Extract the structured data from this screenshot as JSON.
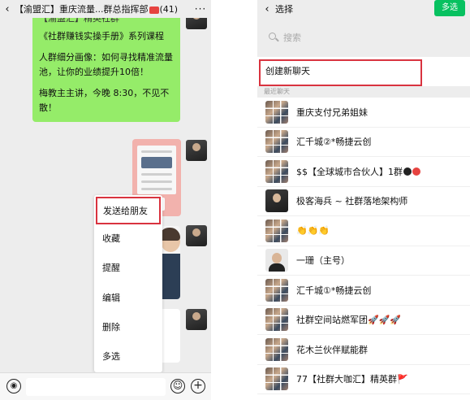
{
  "left_chat": {
    "back": "‹",
    "title": "【渝盟汇】重庆流量...群总指挥部",
    "member_count": "(41)",
    "more": "···",
    "message_cut_line": "【渝盟汇】精英社群",
    "message_paragraphs": [
      "《社群赚钱实操手册》系列课程",
      "人群细分画像：如何寻找精准流量池，让你的业绩提升10倍！",
      "梅教主主讲，今晚 8:30，不见不散！"
    ],
    "context_menu": [
      "发送给朋友",
      "收藏",
      "提醒",
      "编辑",
      "删除",
      "多选"
    ],
    "input_bar": {
      "voice_icon": "◉",
      "emoji_icon": "☺",
      "plus_icon": "+"
    }
  },
  "right_select": {
    "back": "‹",
    "title": "选择",
    "multi_select": "多选",
    "search_placeholder": "搜索",
    "create_new_chat": "创建新聊天",
    "section_label": "最近聊天",
    "chats": [
      {
        "name": "重庆支付兄弟姐妹",
        "avatar": "grid"
      },
      {
        "name": "汇千城②*畅捷云创",
        "avatar": "grid"
      },
      {
        "name": "$$【全球城市合伙人】1群",
        "avatar": "grid",
        "suffix_dots": [
          "#222222",
          "#e64340"
        ]
      },
      {
        "name": "极客海兵 ~ 社群落地架构师",
        "avatar": "portrait"
      },
      {
        "name": "👏👏👏",
        "avatar": "grid"
      },
      {
        "name": "一珊（主号）",
        "avatar": "light"
      },
      {
        "name": "汇千城①*畅捷云创",
        "avatar": "grid"
      },
      {
        "name": "社群空间站燃军团🚀🚀🚀",
        "avatar": "grid"
      },
      {
        "name": "花木兰伙伴赋能群",
        "avatar": "grid"
      },
      {
        "name": "77【社群大咖汇】精英群🚩",
        "avatar": "grid"
      }
    ]
  },
  "colors": {
    "accent_green": "#07c160",
    "bubble_green": "#95ec69",
    "highlight_red": "#d9333f"
  }
}
